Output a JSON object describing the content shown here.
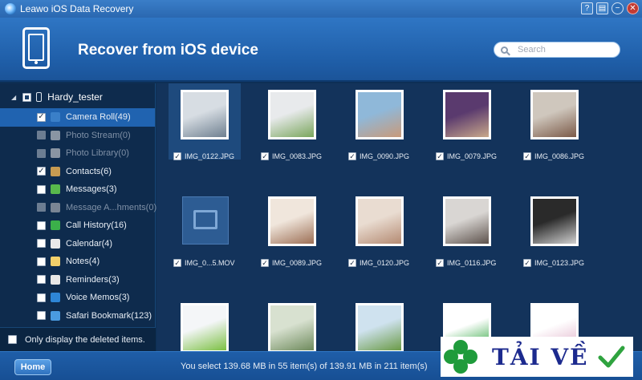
{
  "window": {
    "title": "Leawo iOS Data Recovery",
    "buttons": [
      "?",
      "▤",
      "−",
      "✕"
    ]
  },
  "header": {
    "title": "Recover from iOS device",
    "search_placeholder": "Search"
  },
  "sidebar": {
    "device_name": "Hardy_tester",
    "items": [
      {
        "label": "Camera Roll(49)",
        "checked": true,
        "selected": true,
        "disabled": false,
        "icon": "camera-roll-icon",
        "icon_color": "#3a7fc8"
      },
      {
        "label": "Photo Stream(0)",
        "checked": false,
        "selected": false,
        "disabled": true,
        "icon": "photo-stream-icon",
        "icon_color": "#8a95a3"
      },
      {
        "label": "Photo Library(0)",
        "checked": false,
        "selected": false,
        "disabled": true,
        "icon": "photo-library-icon",
        "icon_color": "#8a95a3"
      },
      {
        "label": "Contacts(6)",
        "checked": true,
        "selected": false,
        "disabled": false,
        "icon": "contacts-icon",
        "icon_color": "#c79b52"
      },
      {
        "label": "Messages(3)",
        "checked": false,
        "selected": false,
        "disabled": false,
        "icon": "messages-icon",
        "icon_color": "#58b84c"
      },
      {
        "label": "Message A...hments(0)",
        "checked": false,
        "selected": false,
        "disabled": true,
        "icon": "message-attachments-icon",
        "icon_color": "#7a8594"
      },
      {
        "label": "Call History(16)",
        "checked": false,
        "selected": false,
        "disabled": false,
        "icon": "call-history-icon",
        "icon_color": "#3bb04a"
      },
      {
        "label": "Calendar(4)",
        "checked": false,
        "selected": false,
        "disabled": false,
        "icon": "calendar-icon",
        "icon_color": "#e9e9e9"
      },
      {
        "label": "Notes(4)",
        "checked": false,
        "selected": false,
        "disabled": false,
        "icon": "notes-icon",
        "icon_color": "#f2d06b"
      },
      {
        "label": "Reminders(3)",
        "checked": false,
        "selected": false,
        "disabled": false,
        "icon": "reminders-icon",
        "icon_color": "#e7e7e7"
      },
      {
        "label": "Voice Memos(3)",
        "checked": false,
        "selected": false,
        "disabled": false,
        "icon": "voice-memos-icon",
        "icon_color": "#2e86d6"
      },
      {
        "label": "Safari Bookmark(123)",
        "checked": false,
        "selected": false,
        "disabled": false,
        "icon": "safari-bookmark-icon",
        "icon_color": "#4a9be0"
      }
    ],
    "only_deleted_label": "Only display the deleted items."
  },
  "gallery": [
    {
      "name": "IMG_0122.JPG",
      "checked": true,
      "selected": true,
      "c1": "#d7dde3",
      "c2": "#6f8090"
    },
    {
      "name": "IMG_0083.JPG",
      "checked": true,
      "selected": false,
      "c1": "#e8eaec",
      "c2": "#7aa65c"
    },
    {
      "name": "IMG_0090.JPG",
      "checked": true,
      "selected": false,
      "c1": "#8fb8d9",
      "c2": "#c99a7a"
    },
    {
      "name": "IMG_0079.JPG",
      "checked": true,
      "selected": false,
      "c1": "#5a3a6e",
      "c2": "#c9a88a"
    },
    {
      "name": "IMG_0086.JPG",
      "checked": true,
      "selected": false,
      "c1": "#cfc7bd",
      "c2": "#7b5a48"
    },
    {
      "name": "IMG_0...5.MOV",
      "checked": true,
      "selected": false,
      "c1": "",
      "c2": ""
    },
    {
      "name": "IMG_0089.JPG",
      "checked": true,
      "selected": false,
      "c1": "#f0e6dc",
      "c2": "#9c6f55"
    },
    {
      "name": "IMG_0120.JPG",
      "checked": true,
      "selected": false,
      "c1": "#e9dcd1",
      "c2": "#b48a72"
    },
    {
      "name": "IMG_0116.JPG",
      "checked": true,
      "selected": false,
      "c1": "#d9d6d3",
      "c2": "#5d524c"
    },
    {
      "name": "IMG_0123.JPG",
      "checked": true,
      "selected": false,
      "c1": "#2a2a2a",
      "c2": "#d0d0d0"
    },
    {
      "name": "",
      "checked": false,
      "selected": false,
      "c1": "#f4f6f8",
      "c2": "#7cc043"
    },
    {
      "name": "",
      "checked": false,
      "selected": false,
      "c1": "#d8e1d0",
      "c2": "#6e8a5c"
    },
    {
      "name": "",
      "checked": false,
      "selected": false,
      "c1": "#cfe2ef",
      "c2": "#6a9a46"
    },
    {
      "name": "",
      "checked": false,
      "selected": false,
      "c1": "#ffffff",
      "c2": "#2aa33a"
    },
    {
      "name": "",
      "checked": false,
      "selected": false,
      "c1": "#ffffff",
      "c2": "#e0b0c8"
    }
  ],
  "footer": {
    "home_label": "Home",
    "status": "You select 139.68 MB in 55 item(s) of 139.91 MB in 211 item(s)"
  },
  "watermark": {
    "text": "TẢI VỀ"
  }
}
